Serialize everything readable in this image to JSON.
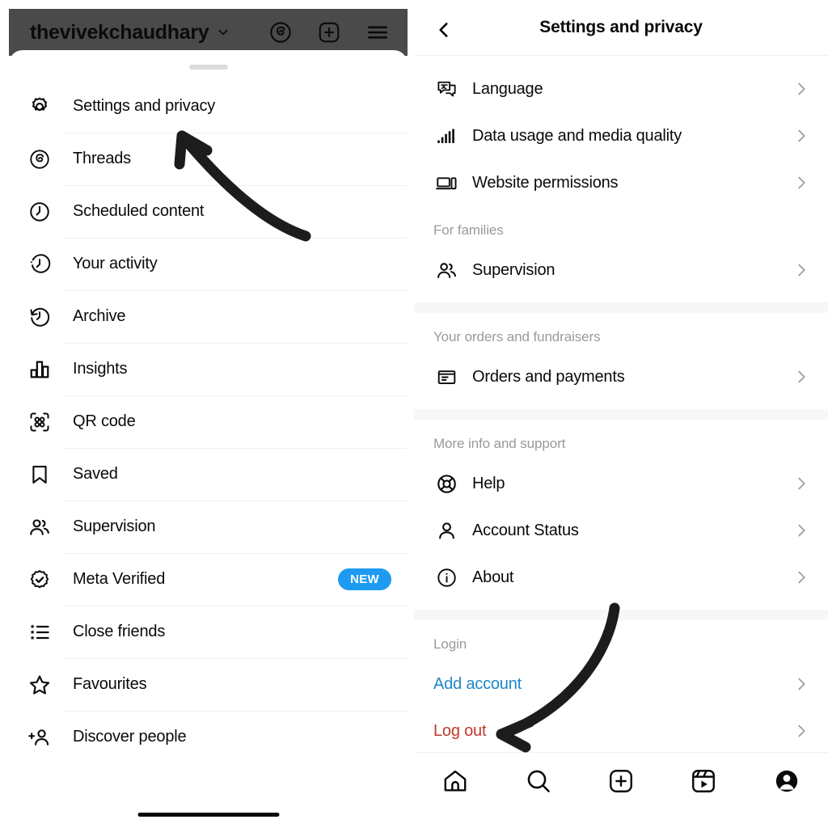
{
  "left_panel": {
    "header": {
      "username": "thevivekchaudhary",
      "chevron_icon": "chevron-down-icon",
      "icons": [
        "threads-icon",
        "new-post-icon",
        "hamburger-menu-icon"
      ]
    },
    "drag_handle": "sheet-drag-handle",
    "menu_items": [
      {
        "label": "Settings and privacy",
        "icon": "gear-icon"
      },
      {
        "label": "Threads",
        "icon": "threads-icon"
      },
      {
        "label": "Scheduled content",
        "icon": "clock-icon"
      },
      {
        "label": "Your activity",
        "icon": "activity-clock-icon"
      },
      {
        "label": "Archive",
        "icon": "archive-clock-icon"
      },
      {
        "label": "Insights",
        "icon": "bar-chart-icon"
      },
      {
        "label": "QR code",
        "icon": "qr-code-icon"
      },
      {
        "label": "Saved",
        "icon": "bookmark-icon"
      },
      {
        "label": "Supervision",
        "icon": "two-people-icon"
      },
      {
        "label": "Meta Verified",
        "icon": "verified-badge-icon",
        "badge": "NEW"
      },
      {
        "label": "Close friends",
        "icon": "star-list-icon"
      },
      {
        "label": "Favourites",
        "icon": "star-icon"
      },
      {
        "label": "Discover people",
        "icon": "add-person-icon"
      }
    ]
  },
  "right_panel": {
    "header": {
      "back_icon": "back-chevron-icon",
      "title": "Settings and privacy"
    },
    "sections": [
      {
        "title": null,
        "rows": [
          {
            "label": "Language",
            "icon": "language-icon",
            "chevron": true
          },
          {
            "label": "Data usage and media quality",
            "icon": "signal-bars-icon",
            "chevron": true
          },
          {
            "label": "Website permissions",
            "icon": "devices-icon",
            "chevron": true
          }
        ]
      },
      {
        "title": "For families",
        "rows": [
          {
            "label": "Supervision",
            "icon": "two-people-icon",
            "chevron": true
          }
        ]
      },
      {
        "title": "Your orders and fundraisers",
        "rows": [
          {
            "label": "Orders and payments",
            "icon": "box-icon",
            "chevron": true
          }
        ]
      },
      {
        "title": "More info and support",
        "rows": [
          {
            "label": "Help",
            "icon": "lifebuoy-icon",
            "chevron": true
          },
          {
            "label": "Account Status",
            "icon": "person-icon",
            "chevron": true
          },
          {
            "label": "About",
            "icon": "info-icon",
            "chevron": true
          }
        ]
      },
      {
        "title": "Login",
        "rows": [
          {
            "label": "Add account",
            "icon": null,
            "chevron": true,
            "style": "link-blue"
          },
          {
            "label": "Log out",
            "icon": null,
            "chevron": true,
            "style": "link-red"
          }
        ]
      }
    ],
    "bottom_nav": [
      {
        "icon": "home-icon"
      },
      {
        "icon": "search-icon"
      },
      {
        "icon": "create-post-icon"
      },
      {
        "icon": "reels-icon"
      },
      {
        "icon": "profile-icon"
      }
    ]
  },
  "annotations": {
    "left_arrow": "curved-arrow-pointing-to-settings-and-privacy",
    "right_arrow": "curved-arrow-pointing-to-log-out"
  },
  "colors": {
    "header_background": "#4a4a4a",
    "badge_new": "#1d9bf0",
    "link_blue": "#1e87c9",
    "log_out_red": "#c0392b",
    "section_band": "#f7f7f7",
    "divider": "#efefef",
    "muted_text": "#9a9a9a"
  }
}
